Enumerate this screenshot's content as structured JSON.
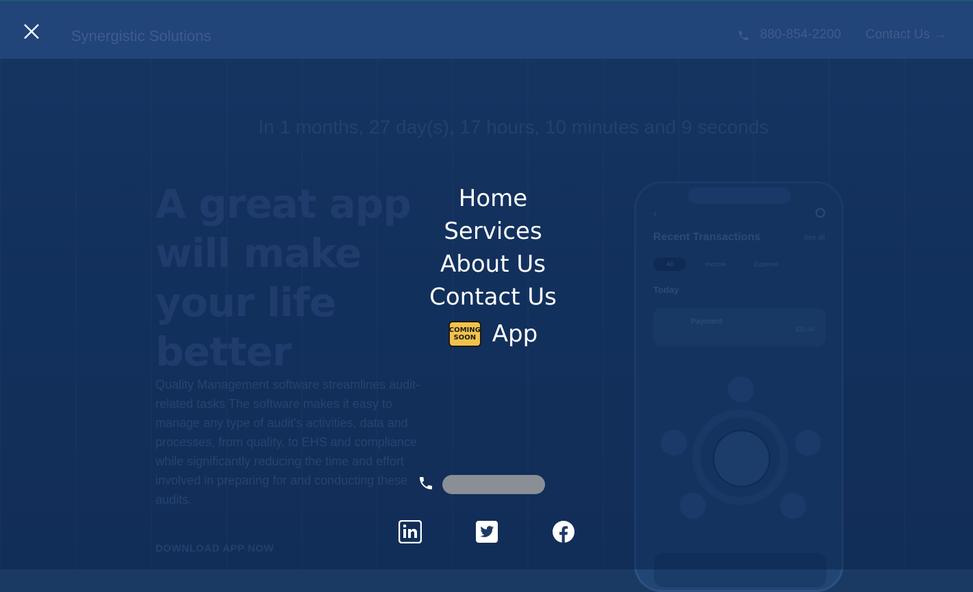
{
  "header": {
    "brand": "Synergistic Solutions",
    "phone": "880-854-2200",
    "contact_label": "Contact Us →"
  },
  "countdown": "In 1 months, 27 day(s), 17 hours, 10 minutes and 9 seconds",
  "hero": {
    "title": "A great app will make your life better",
    "description": "Quality Management software streamlines audit-related tasks The software makes it easy to manage any type of audit's activities, data and processes, from quality, to EHS and compliance while significantly reducing the time and effort involved in preparing for and conducting these audits.",
    "download_label": "DOWNLOAD APP NOW"
  },
  "phone_mockup": {
    "title": "Recent Transactions",
    "see_all": "See all",
    "filters": [
      "All",
      "Income",
      "Expense"
    ],
    "today": "Today",
    "card_title": "Payment",
    "card_amount": "$30.00"
  },
  "menu": {
    "items": [
      "Home",
      "Services",
      "About Us",
      "Contact Us"
    ],
    "app_label": "App",
    "coming_soon_line1": "COMING",
    "coming_soon_line2": "SOON",
    "phone_number": "",
    "social": [
      "linkedin-icon",
      "twitter-icon",
      "facebook-icon"
    ]
  },
  "colors": {
    "overlay": "#0b2a5a",
    "menu_text": "#ffffff",
    "badge": "#f2c34b"
  }
}
